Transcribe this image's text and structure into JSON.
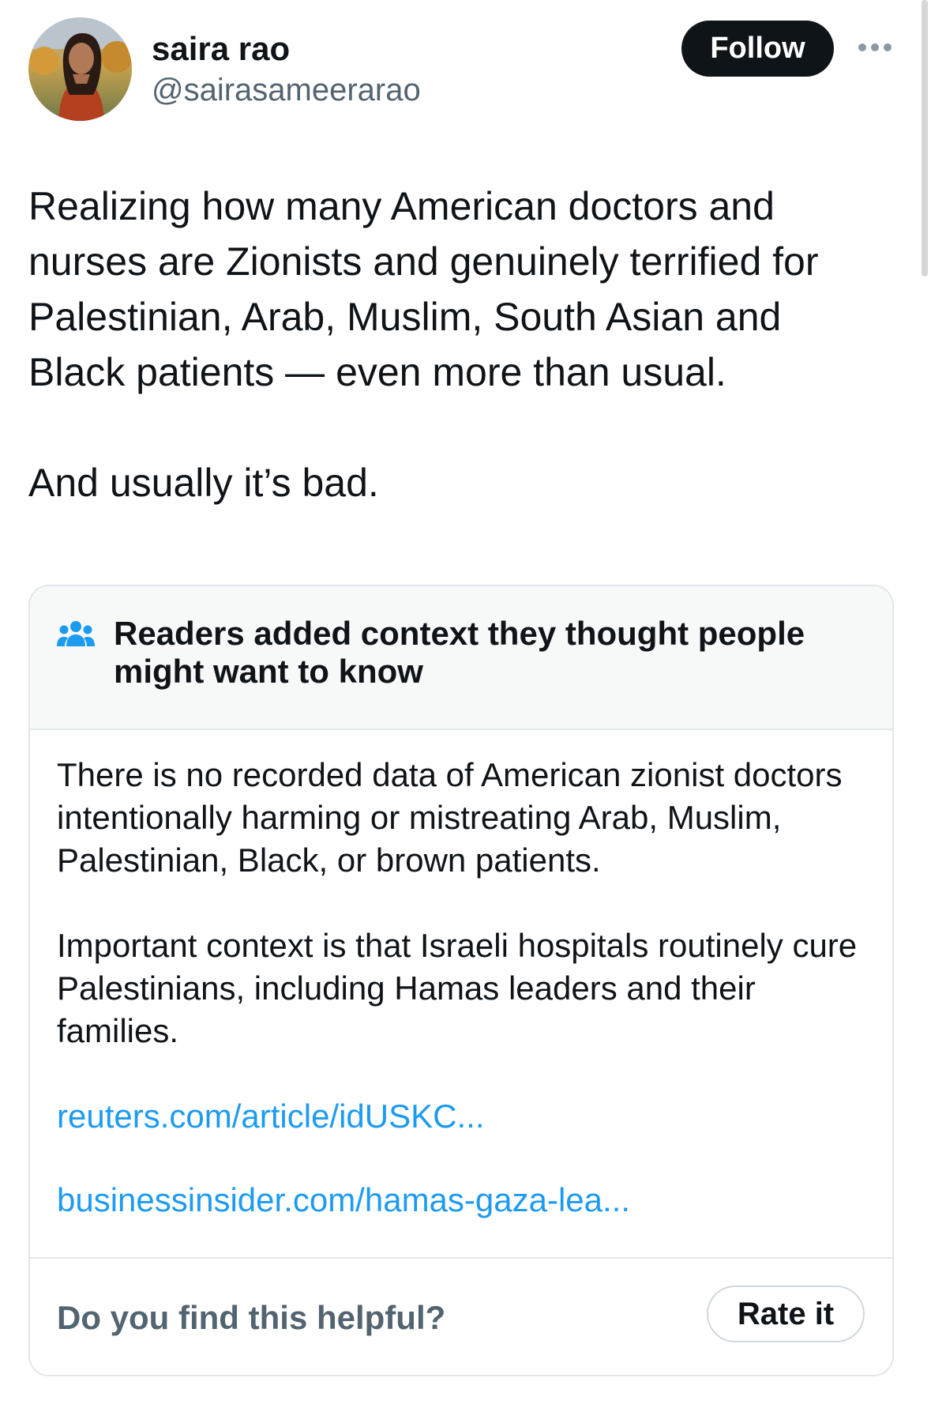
{
  "author": {
    "display_name": "saira rao",
    "handle": "@sairasameerarao",
    "avatar_icon": "profile-photo"
  },
  "actions": {
    "follow_label": "Follow",
    "more_icon": "ellipsis-icon"
  },
  "tweet": {
    "text": "Realizing how many American doctors and nurses are Zionists and genuinely terrified for Palestinian, Arab, Muslim, South Asian and Black patients — even more than usual.\n\nAnd usually it’s bad."
  },
  "community_note": {
    "icon": "people-group-icon",
    "title": "Readers added context they thought people might want to know",
    "paragraphs": [
      "There is no recorded data of American zionist doctors intentionally harming or mistreating Arab, Muslim, Palestinian, Black, or brown patients.",
      "Important context is that Israeli hospitals routinely cure Palestinians, including Hamas leaders and their families."
    ],
    "links": [
      "reuters.com/article/idUSKC...",
      "businessinsider.com/hamas-gaza-lea..."
    ],
    "helpful_question": "Do you find this helpful?",
    "rate_label": "Rate it"
  },
  "colors": {
    "link": "#1d9bf0",
    "primary_text": "#0f1419",
    "secondary_text": "#536471",
    "follow_bg": "#0f1419",
    "note_header_bg": "#f7f9f9",
    "border": "#e3e6e8"
  }
}
